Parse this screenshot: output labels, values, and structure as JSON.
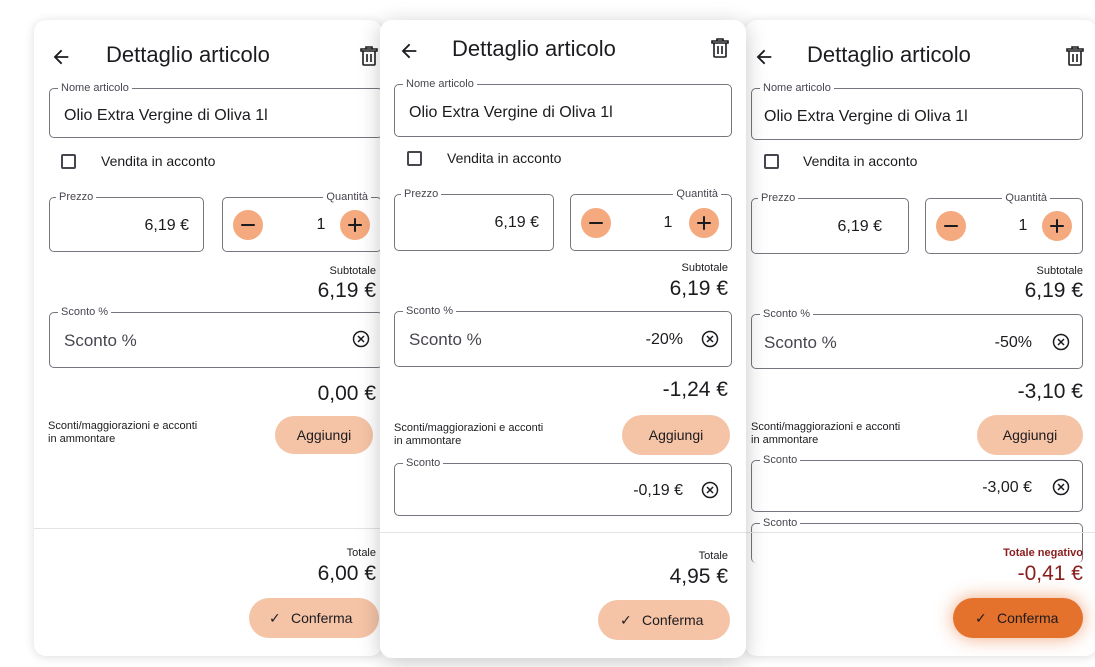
{
  "header": {
    "title": "Dettaglio articolo",
    "back_icon": "arrow-left-icon",
    "delete_icon": "trash-icon"
  },
  "labels": {
    "nome_articolo": "Nome articolo",
    "vendita_in_acconto": "Vendita in acconto",
    "prezzo": "Prezzo",
    "quantita": "Quantità",
    "subtotale": "Subtotale",
    "sconto_percent": "Sconto %",
    "sconti_desc": "Sconti/maggiorazioni e acconti in ammontare",
    "aggiungi": "Aggiungi",
    "sconto": "Sconto",
    "totale": "Totale",
    "totale_negativo": "Totale negativo",
    "conferma": "Conferma"
  },
  "colors": {
    "accent_light": "#f5c3a6",
    "accent_button": "#f5a97e",
    "accent_strong": "#e4712c",
    "negative": "#8a1c1c"
  },
  "panels": [
    {
      "nome_articolo": "Olio Extra Vergine di Oliva 1l",
      "vendita_in_acconto": false,
      "prezzo": "6,19 €",
      "quantita": "1",
      "subtotale": "6,19 €",
      "sconto_percent_value": "",
      "sconto_percent_placeholder": "Sconto %",
      "sconto_amount": "0,00 €",
      "sconti_lines": [],
      "totale": "6,00 €",
      "totale_negative": false
    },
    {
      "nome_articolo": "Olio Extra Vergine di Oliva 1l",
      "vendita_in_acconto": false,
      "prezzo": "6,19 €",
      "quantita": "1",
      "subtotale": "6,19 €",
      "sconto_percent_value": "-20%",
      "sconto_percent_placeholder": "Sconto %",
      "sconto_amount": "-1,24 €",
      "sconti_lines": [
        {
          "label": "Sconto",
          "value": "-0,19 €"
        }
      ],
      "totale": "4,95 €",
      "totale_negative": false
    },
    {
      "nome_articolo": "Olio Extra Vergine di Oliva 1l",
      "vendita_in_acconto": false,
      "prezzo": "6,19 €",
      "quantita": "1",
      "subtotale": "6,19 €",
      "sconto_percent_value": "-50%",
      "sconto_percent_placeholder": "Sconto %",
      "sconto_amount": "-3,10 €",
      "sconti_lines": [
        {
          "label": "Sconto",
          "value": "-3,00 €"
        },
        {
          "label": "Sconto",
          "value": ""
        }
      ],
      "totale": "-0,41 €",
      "totale_negative": true
    }
  ]
}
